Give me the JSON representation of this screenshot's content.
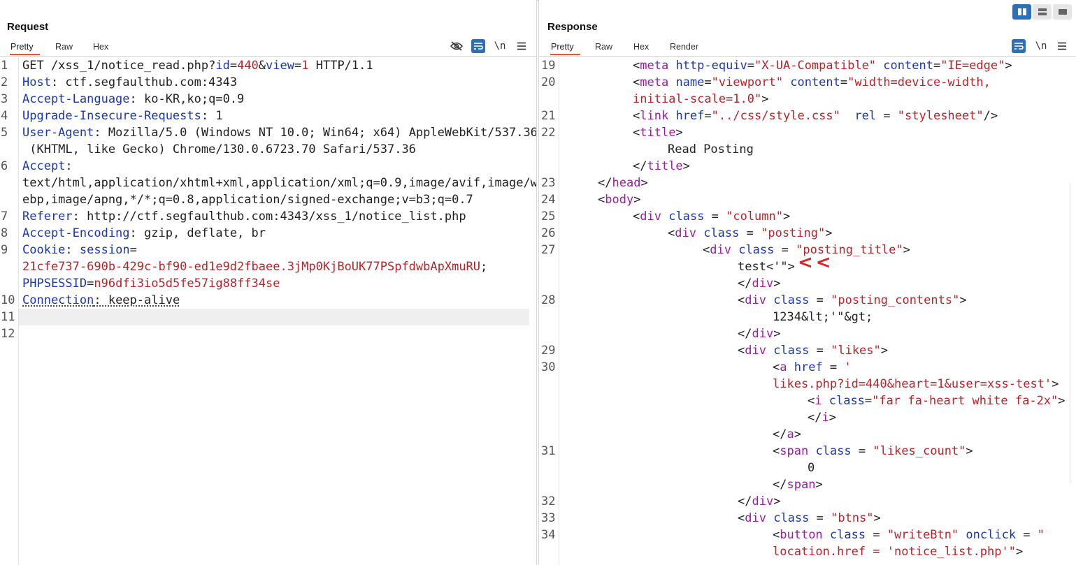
{
  "request": {
    "title": "Request",
    "tabs": [
      "Pretty",
      "Raw",
      "Hex"
    ],
    "active_tab": "Pretty",
    "toolbar": {
      "hide_icon": "eye-off-icon",
      "wrap_icon": "wrap-lines-icon",
      "newline_label": "\\n",
      "menu_icon": "hamburger-menu-icon"
    },
    "line_numbers": [
      "1",
      "2",
      "3",
      "4",
      "5",
      "6",
      "7",
      "8",
      "9",
      "10",
      "11",
      "12"
    ],
    "lines": {
      "l1": {
        "a": "GET /xss_1/notice_read.php?",
        "b": "id",
        "c": "=",
        "d": "440",
        "e": "&",
        "f": "view",
        "g": "=",
        "h": "1",
        "i": " HTTP/1.1"
      },
      "l2": {
        "k": "Host",
        "v": ": ctf.segfaulthub.com:4343"
      },
      "l3": {
        "k": "Accept-Language",
        "v": ": ko-KR,ko;q=0.9"
      },
      "l4": {
        "k": "Upgrade-Insecure-Requests",
        "v": ": 1"
      },
      "l5": {
        "k": "User-Agent",
        "v": ": Mozilla/5.0 (Windows NT 10.0; Win64; x64) AppleWebKit/537.36",
        "v2": " (KHTML, like Gecko) Chrome/130.0.6723.70 Safari/537.36"
      },
      "l6": {
        "k": "Accept",
        "v": ":",
        "v2": "text/html,application/xhtml+xml,application/xml;q=0.9,image/avif,image/w",
        "v3": "ebp,image/apng,*/*;q=0.8,application/signed-exchange;v=b3;q=0.7"
      },
      "l7": {
        "k": "Referer",
        "v": ": http://ctf.segfaulthub.com:4343/xss_1/notice_list.php"
      },
      "l8": {
        "k": "Accept-Encoding",
        "v": ": gzip, deflate, br"
      },
      "l9": {
        "k": "Cookie",
        "v": ": ",
        "k2": "session",
        "eq": "=",
        "v2": "21cfe737-690b-429c-bf90-ed1e9d2fbaee.3jMp0KjBoUK77PSpfdwbApXmuRU",
        "semi": ";",
        "k3": "PHPSESSID",
        "eq2": "=",
        "v3": "n96dfi3io5d5fe57ig88ff34se"
      },
      "l10": {
        "k": "Connection",
        "v": ": keep-alive"
      }
    }
  },
  "response": {
    "title": "Response",
    "tabs": [
      "Pretty",
      "Raw",
      "Hex",
      "Render"
    ],
    "active_tab": "Pretty",
    "toolbar": {
      "wrap_icon": "wrap-lines-icon",
      "newline_label": "\\n",
      "menu_icon": "hamburger-menu-icon"
    },
    "line_numbers": [
      "19",
      "20",
      "21",
      "22",
      "23",
      "24",
      "25",
      "26",
      "27",
      "28",
      "29",
      "30",
      "31",
      "32",
      "33",
      "34"
    ],
    "code": {
      "r19": {
        "a": "<",
        "t": "meta",
        "a1": " http-equiv",
        "e1": "=",
        "s1": "\"X-UA-Compatible\"",
        "a2": " content",
        "e2": "=",
        "s2": "\"IE=edge\"",
        "z": ">"
      },
      "r20": {
        "a": "<",
        "t": "meta",
        "a1": " name",
        "e1": "=",
        "s1": "\"viewport\"",
        "a2": " content",
        "e2": "=",
        "s2": "\"width=device-width,",
        "s3": "initial-scale=1.0\"",
        "z": ">"
      },
      "r21": {
        "a": "<",
        "t": "link",
        "a1": " href",
        "e1": "=",
        "s1": "\"../css/style.css\"",
        "a2": "  rel",
        "e2": " = ",
        "s2": "\"stylesheet\"",
        "z": "/>"
      },
      "r22": {
        "a": "<",
        "t": "title",
        "z": ">",
        "text": "Read Posting",
        "c1": "</",
        "ct": "title",
        "c2": ">"
      },
      "r23": {
        "a": "</",
        "t": "head",
        "z": ">"
      },
      "r24": {
        "a": "<",
        "t": "body",
        "z": ">"
      },
      "r25": {
        "a": "<",
        "t": "div",
        "a1": " class",
        "e1": " = ",
        "s1": "\"column\"",
        "z": ">"
      },
      "r26": {
        "a": "<",
        "t": "div",
        "a1": " class",
        "e1": " = ",
        "s1": "\"posting\"",
        "z": ">"
      },
      "r27": {
        "a": "<",
        "t": "div",
        "a1": " class",
        "e1": " = ",
        "s1": "\"posting_title\"",
        "z": ">",
        "text": "test<'\">",
        "c1": "</",
        "ct": "div",
        "c2": ">"
      },
      "r28": {
        "a": "<",
        "t": "div",
        "a1": " class",
        "e1": " = ",
        "s1": "\"posting_contents\"",
        "z": ">",
        "text": "1234&lt;'\"&gt;",
        "c1": "</",
        "ct": "div",
        "c2": ">"
      },
      "r29": {
        "a": "<",
        "t": "div",
        "a1": " class",
        "e1": " = ",
        "s1": "\"likes\"",
        "z": ">"
      },
      "r30": {
        "a": "<",
        "t": "a",
        "a1": " href",
        "e1": " = ",
        "s1": "'",
        "s2": "likes.php?id=440&heart=1&user=xss-test'",
        "z": ">",
        "ia": "<",
        "it": "i",
        "ia1": " class",
        "ie1": "=",
        "is1": "\"far fa-heart white fa-2x\"",
        "iz": ">",
        "ic1": "</",
        "ict": "i",
        "ic2": ">",
        "c1": "</",
        "ct": "a",
        "c2": ">"
      },
      "r31": {
        "a": "<",
        "t": "span",
        "a1": " class",
        "e1": " = ",
        "s1": "\"likes_count\"",
        "z": ">",
        "text": "0",
        "c1": "</",
        "ct": "span",
        "c2": ">"
      },
      "r32": {
        "c1": "</",
        "ct": "div",
        "c2": ">"
      },
      "r33": {
        "a": "<",
        "t": "div",
        "a1": " class",
        "e1": " = ",
        "s1": "\"btns\"",
        "z": ">"
      },
      "r34": {
        "a": "<",
        "t": "button",
        "a1": " class",
        "e1": " = ",
        "s1": "\"writeBtn\"",
        "a2": " onclick",
        "e2": " = ",
        "s2": "\"",
        "s3": "location.href = 'notice_list.php'\"",
        "z": ">"
      }
    },
    "annotation": "<<"
  },
  "layout_switch": [
    "split-vertical-icon",
    "split-horizontal-icon",
    "single-panel-icon"
  ]
}
